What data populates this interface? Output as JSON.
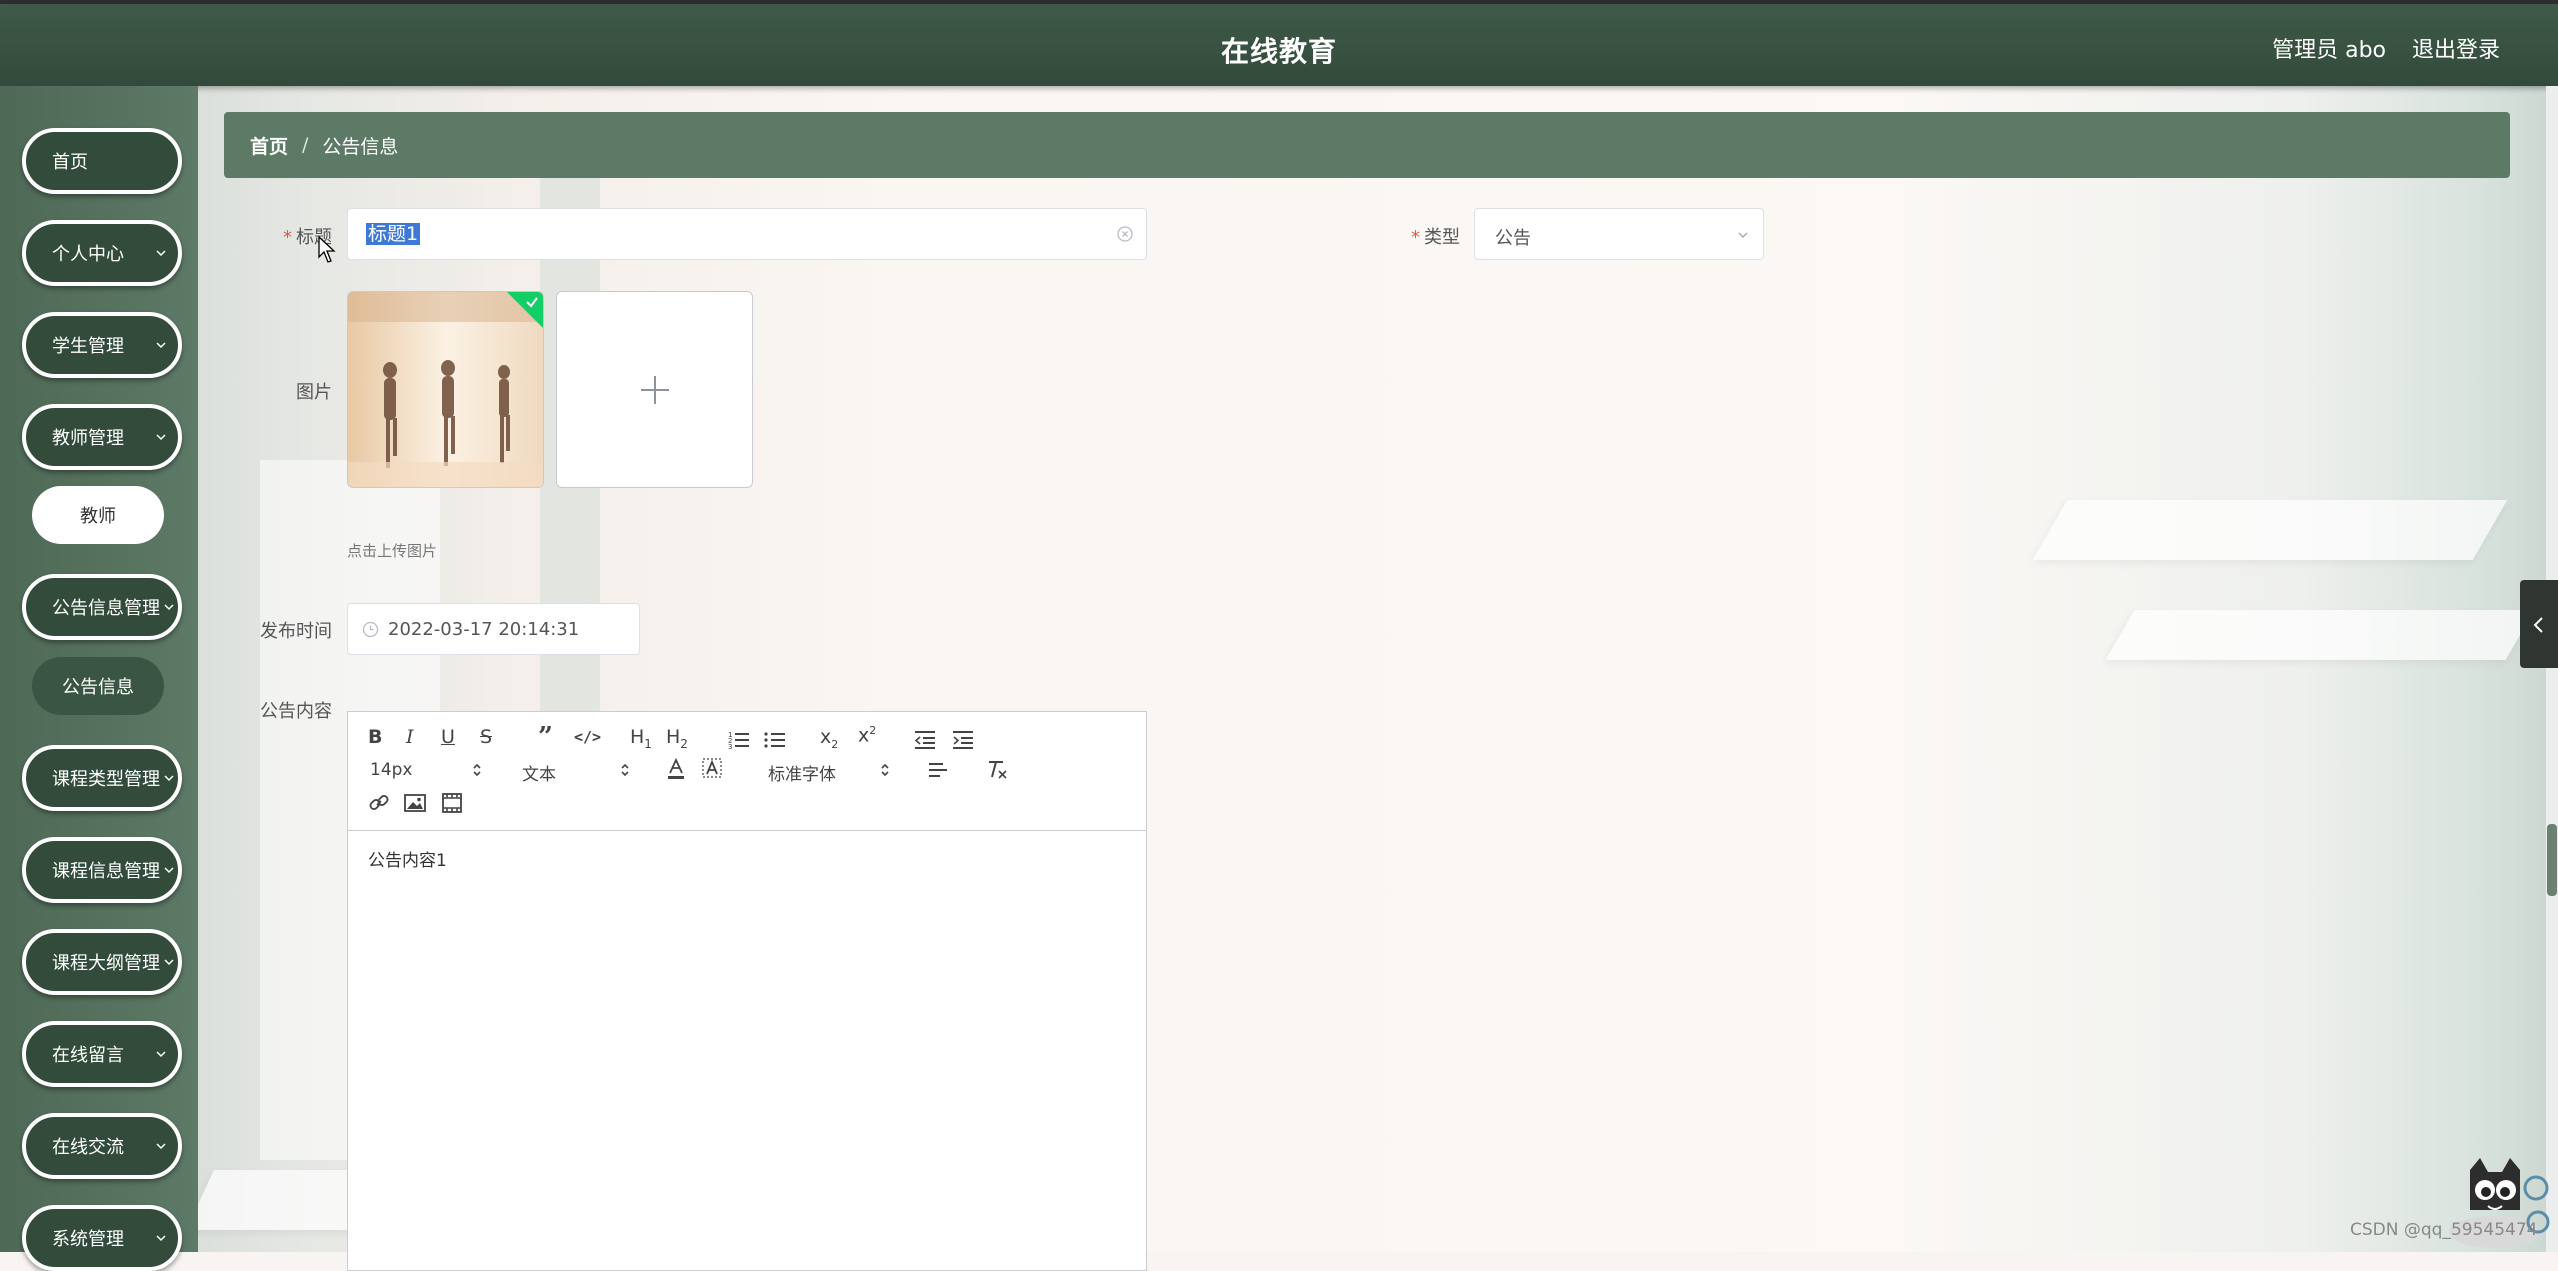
{
  "app": {
    "title": "在线教育"
  },
  "header": {
    "user": "管理员 abo",
    "logout": "退出登录"
  },
  "sidebar": {
    "items": [
      {
        "label": "首页",
        "has_chevron": false
      },
      {
        "label": "个人中心",
        "has_chevron": true
      },
      {
        "label": "学生管理",
        "has_chevron": true
      },
      {
        "label": "教师管理",
        "has_chevron": true
      },
      {
        "label": "教师",
        "sub": true
      },
      {
        "label": "公告信息管理",
        "has_chevron": true
      },
      {
        "label": "公告信息",
        "sub": true,
        "active": true
      },
      {
        "label": "课程类型管理",
        "has_chevron": true
      },
      {
        "label": "课程信息管理",
        "has_chevron": true
      },
      {
        "label": "课程大纲管理",
        "has_chevron": true
      },
      {
        "label": "在线留言",
        "has_chevron": true
      },
      {
        "label": "在线交流",
        "has_chevron": true
      },
      {
        "label": "系统管理",
        "has_chevron": true
      }
    ]
  },
  "breadcrumb": {
    "home": "首页",
    "separator": "/",
    "current": "公告信息"
  },
  "form": {
    "title_label": "标题",
    "title_value": "标题1",
    "type_label": "类型",
    "type_value": "公告",
    "image_label": "图片",
    "upload_hint": "点击上传图片",
    "publish_time_label": "发布时间",
    "publish_time_value": "2022-03-17 20:14:31",
    "content_label": "公告内容",
    "content_value": "公告内容1"
  },
  "editor": {
    "font_size": "14px",
    "header_select": "文本",
    "font_family": "标准字体",
    "buttons": [
      "B",
      "I",
      "U",
      "S",
      "❞",
      "</>",
      "H1",
      "H2",
      "ordered-list",
      "bullet-list",
      "x₂",
      "x²",
      "outdent",
      "indent",
      "color",
      "background",
      "align",
      "clean",
      "link",
      "image",
      "video"
    ]
  },
  "watermark": "CSDN @qq_59545474",
  "colors": {
    "header": "#3f5a48",
    "sidebar": "#5d7a66",
    "menu": "#324b3b",
    "breadcrumb": "#5c7a66",
    "success": "#13ce66",
    "required": "#e2574c"
  }
}
